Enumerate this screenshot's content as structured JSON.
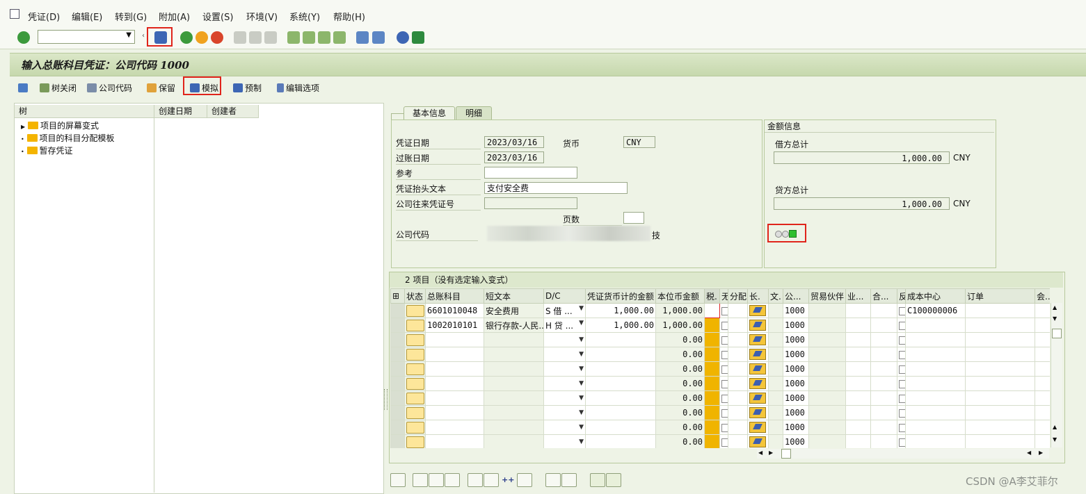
{
  "menu": [
    "凭证(D)",
    "编辑(E)",
    "转到(G)",
    "附加(A)",
    "设置(S)",
    "环境(V)",
    "系统(Y)",
    "帮助(H)"
  ],
  "title": "输入总账科目凭证：公司代码 1000",
  "app_toolbar": {
    "tree_close": "树关闭",
    "company_code": "公司代码",
    "hold": "保留",
    "simulate": "模拟",
    "park": "预制",
    "edit_options": "编辑选项"
  },
  "tree": {
    "headers": [
      "树",
      "创建日期",
      "创建者"
    ],
    "nodes": [
      "项目的屏幕变式",
      "项目的科目分配模板",
      "暂存凭证"
    ]
  },
  "tabs": [
    "基本信息",
    "明细"
  ],
  "basic": {
    "doc_date_label": "凭证日期",
    "doc_date": "2023/03/16",
    "currency_label": "货币",
    "currency": "CNY",
    "post_date_label": "过账日期",
    "post_date": "2023/03/16",
    "reference_label": "参考",
    "reference": "",
    "header_text_label": "凭证抬头文本",
    "header_text": "支付安全费",
    "intercompany_label": "公司往来凭证号",
    "page_label": "页数",
    "company_label": "公司代码",
    "company_suffix": "技"
  },
  "amounts": {
    "title": "金额信息",
    "debit_label": "借方总计",
    "debit": "1,000.00",
    "debit_cur": "CNY",
    "credit_label": "贷方总计",
    "credit": "1,000.00",
    "credit_cur": "CNY"
  },
  "grid": {
    "title": "2 项目（没有选定输入变式）",
    "headers": [
      "状态",
      "总账科目",
      "短文本",
      "D/C",
      "凭证货币计的金额",
      "本位币金额",
      "税.",
      "无",
      "分配",
      "长.",
      "文.",
      "公...",
      "贸易伙伴",
      "业...",
      "合...",
      "反",
      "成本中心",
      "订单",
      "会..."
    ],
    "rows": [
      {
        "account": "6601010048",
        "text": "安全费用",
        "dc": "S 借 ...",
        "amount": "1,000.00",
        "local": "1,000.00",
        "company": "1000",
        "cost_center": "C100000006"
      },
      {
        "account": "1002010101",
        "text": "银行存款-人民...",
        "dc": "H 贷 ...",
        "amount": "1,000.00",
        "local": "1,000.00",
        "company": "1000",
        "cost_center": ""
      },
      {
        "account": "",
        "text": "",
        "dc": "",
        "amount": "",
        "local": "0.00",
        "company": "1000",
        "cost_center": ""
      },
      {
        "account": "",
        "text": "",
        "dc": "",
        "amount": "",
        "local": "0.00",
        "company": "1000",
        "cost_center": ""
      },
      {
        "account": "",
        "text": "",
        "dc": "",
        "amount": "",
        "local": "0.00",
        "company": "1000",
        "cost_center": ""
      },
      {
        "account": "",
        "text": "",
        "dc": "",
        "amount": "",
        "local": "0.00",
        "company": "1000",
        "cost_center": ""
      },
      {
        "account": "",
        "text": "",
        "dc": "",
        "amount": "",
        "local": "0.00",
        "company": "1000",
        "cost_center": ""
      },
      {
        "account": "",
        "text": "",
        "dc": "",
        "amount": "",
        "local": "0.00",
        "company": "1000",
        "cost_center": ""
      },
      {
        "account": "",
        "text": "",
        "dc": "",
        "amount": "",
        "local": "0.00",
        "company": "1000",
        "cost_center": ""
      },
      {
        "account": "",
        "text": "",
        "dc": "",
        "amount": "",
        "local": "0.00",
        "company": "1000",
        "cost_center": ""
      }
    ]
  },
  "watermark": "CSDN @A李艾菲尔"
}
